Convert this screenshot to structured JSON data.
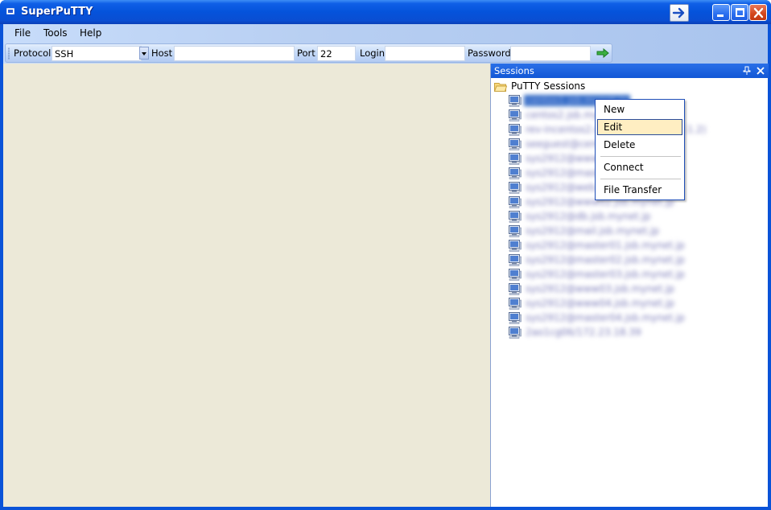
{
  "window": {
    "title": "SuperPuTTY"
  },
  "menubar": {
    "items": [
      {
        "label": "File"
      },
      {
        "label": "Tools"
      },
      {
        "label": "Help"
      }
    ]
  },
  "toolbar": {
    "protocol_label": "Protocol",
    "protocol_value": "SSH",
    "host_label": "Host",
    "host_value": "",
    "port_label": "Port",
    "port_value": "22",
    "login_label": "Login",
    "login_value": "",
    "password_label": "Password",
    "password_value": "",
    "connect_icon": "green-arrow-icon"
  },
  "sessions_panel": {
    "title": "Sessions",
    "root_label": "PuTTY Sessions",
    "items": [
      {
        "label": "centos1.jsb.mynet.jp",
        "selected": true
      },
      {
        "label": "centos2.jsb.mynet.jp"
      },
      {
        "label": "rev-incentos2.mynet.jp (192.168.1.2)"
      },
      {
        "label": "seeguest@centos2.mynet.jp"
      },
      {
        "label": "sys2912@www.mynet.jp"
      },
      {
        "label": "sys2912@master.jsb.mynet.jp"
      },
      {
        "label": "sys2912@web.jsb.mynet.jp"
      },
      {
        "label": "sys2912@www02.jsb.mynet.jp"
      },
      {
        "label": "sys2912@db.jsb.mynet.jp"
      },
      {
        "label": "sys2912@mail.jsb.mynet.jp"
      },
      {
        "label": "sys2912@master01.jsb.mynet.jp"
      },
      {
        "label": "sys2912@master02.jsb.mynet.jp"
      },
      {
        "label": "sys2912@master03.jsb.mynet.jp"
      },
      {
        "label": "sys2912@www03.jsb.mynet.jp"
      },
      {
        "label": "sys2912@www04.jsb.mynet.jp"
      },
      {
        "label": "sys2912@master04.jsb.mynet.jp"
      },
      {
        "label": "2ao1cg06/172.23.18.39"
      }
    ]
  },
  "context_menu": {
    "items": [
      {
        "label": "New"
      },
      {
        "label": "Edit",
        "highlighted": true
      },
      {
        "label": "Delete"
      },
      {
        "label": "Connect"
      },
      {
        "label": "File Transfer"
      }
    ]
  },
  "colors": {
    "titlebar": "#0553db",
    "selection": "#316ac5",
    "menu_highlight": "#ffeec2",
    "workspace": "#ece9d8"
  }
}
